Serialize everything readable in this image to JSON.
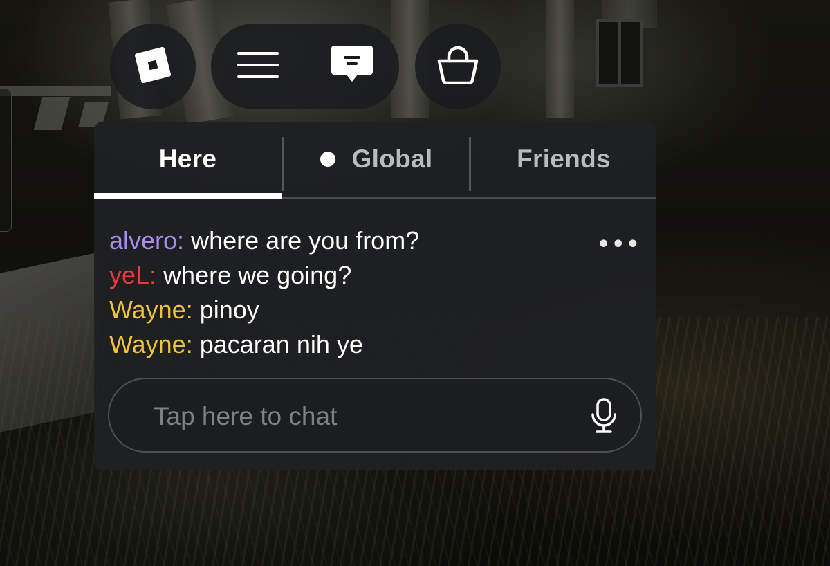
{
  "topbar": {
    "roblox_button_icon": "roblox-logo-icon",
    "menu_button_icon": "hamburger-menu-icon",
    "chat_button_icon": "chat-bubble-icon",
    "shop_button_icon": "shopping-bag-icon"
  },
  "chat": {
    "tabs": [
      {
        "label": "Here",
        "active": true
      },
      {
        "label": "Global",
        "active": false,
        "indicator_dot": true
      },
      {
        "label": "Friends",
        "active": false
      }
    ],
    "messages": [
      {
        "user": "alvero:",
        "text": " where are you from?",
        "color": "#a98cf0"
      },
      {
        "user": "yeL:",
        "text": " where we going?",
        "color": "#ea3a3e"
      },
      {
        "user": "Wayne:",
        "text": " pinoy",
        "color": "#f0c23c"
      },
      {
        "user": "Wayne:",
        "text": " pacaran nih ye",
        "color": "#f0c23c"
      }
    ],
    "more_label": "•••",
    "input": {
      "placeholder": "Tap here to chat",
      "value": "",
      "mic_icon": "microphone-icon"
    }
  }
}
